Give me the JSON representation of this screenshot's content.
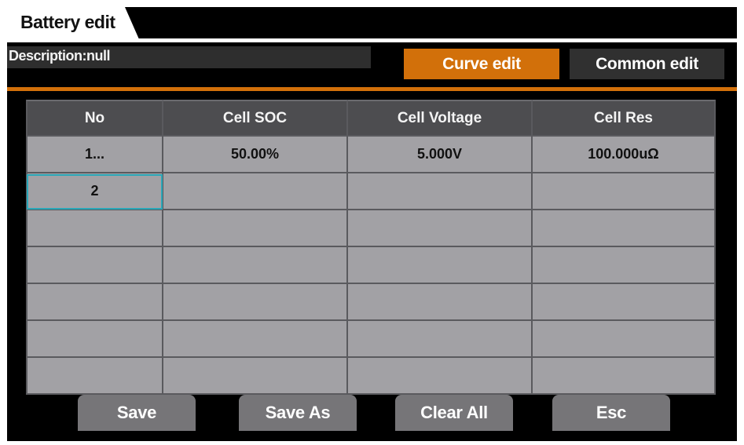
{
  "header": {
    "title": "Battery edit",
    "description": "Description:null"
  },
  "tabs": {
    "curve_edit": "Curve edit",
    "common_edit": "Common edit"
  },
  "table": {
    "columns": [
      "No",
      "Cell SOC",
      "Cell Voltage",
      "Cell Res"
    ],
    "rows": [
      [
        "1...",
        "50.00%",
        "5.000V",
        "100.000uΩ"
      ],
      [
        "2",
        "",
        "",
        ""
      ],
      [
        "",
        "",
        "",
        ""
      ],
      [
        "",
        "",
        "",
        ""
      ],
      [
        "",
        "",
        "",
        ""
      ],
      [
        "",
        "",
        "",
        ""
      ],
      [
        "",
        "",
        "",
        ""
      ]
    ],
    "selected_row": 1,
    "selected_col": 0
  },
  "buttons": {
    "save": "Save",
    "save_as": "Save As",
    "clear_all": "Clear All",
    "esc": "Esc"
  },
  "colors": {
    "accent": "#d2700a",
    "selection": "#2aa7b8",
    "cell_bg": "#a2a1a5",
    "header_bg": "#4d4d50"
  }
}
